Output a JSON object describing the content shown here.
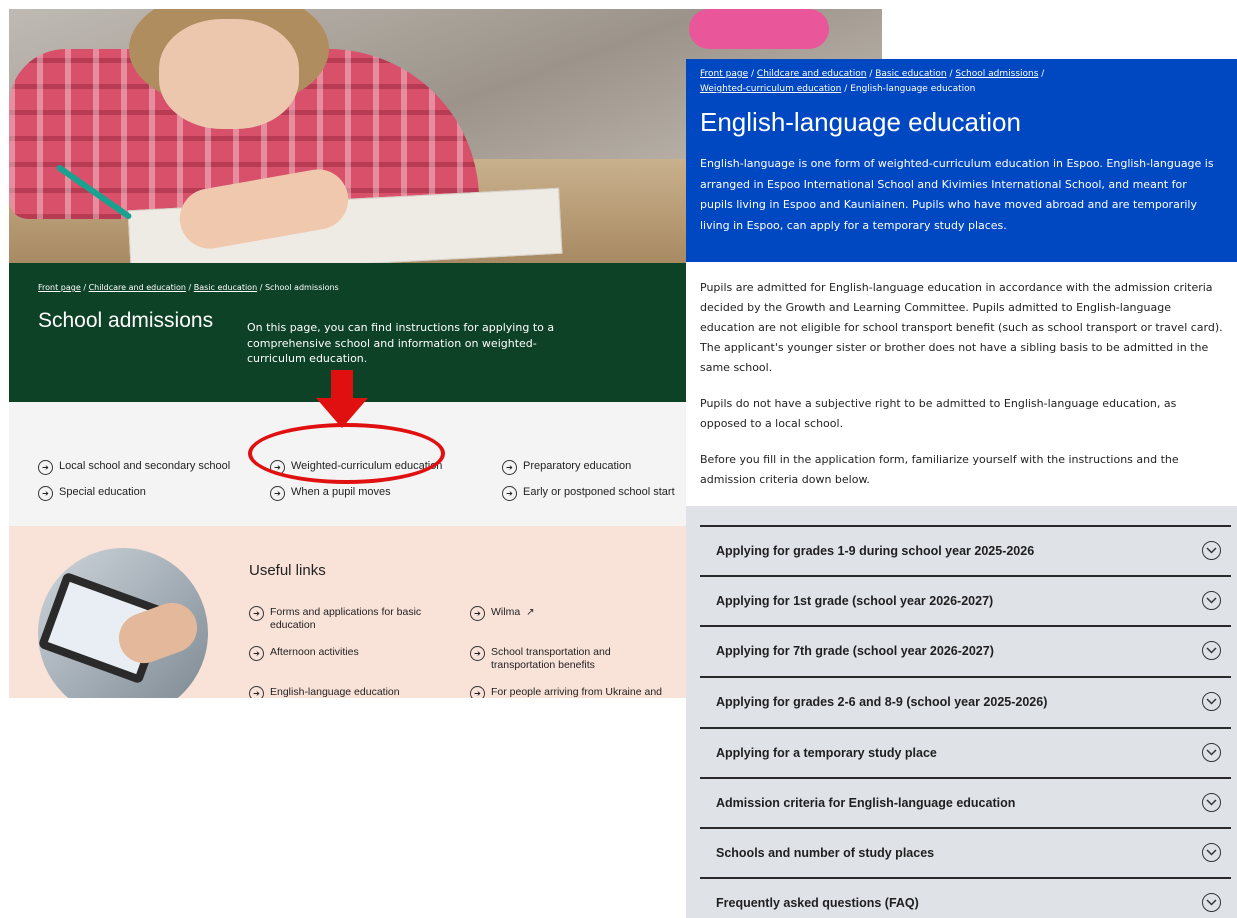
{
  "left_page": {
    "breadcrumb": {
      "items": [
        "Front page",
        "Childcare and education",
        "Basic education"
      ],
      "sep": "/",
      "current": "School admissions"
    },
    "title": "School admissions",
    "intro": "On this page, you can find instructions for applying to a comprehensive school and information on weighted-curriculum education.",
    "sub_links": [
      "Local school and secondary school",
      "Weighted-curriculum education",
      "Preparatory education",
      "Special education",
      "When a pupil moves",
      "Early or postponed school start"
    ],
    "useful_links": {
      "heading": "Useful links",
      "items": [
        "Forms and applications for basic education",
        "Wilma",
        "Afternoon activities",
        "School transportation and transportation benefits",
        "English-language education",
        "For people arriving from Ukraine and applying for basic education"
      ]
    },
    "link_icon": "circle-arrow-icon",
    "external_icon": "external-link-icon"
  },
  "annotation": {
    "color": "#e11010",
    "arrow_icon": "down-arrow-icon"
  },
  "right_page": {
    "breadcrumb": {
      "items": [
        "Front page",
        "Childcare and education",
        "Basic education",
        "School admissions",
        "Weighted-curriculum education"
      ],
      "sep": "/",
      "current": "English-language education"
    },
    "title": "English-language education",
    "intro": "English-language is one form of weighted-curriculum education in Espoo. English-language is arranged in Espoo International School and Kivimies International School, and meant for pupils living in Espoo and Kauniainen. Pupils who have moved abroad and are temporarily living in Espoo, can apply for a temporary study places.",
    "paragraphs": [
      "Pupils are admitted for English-language education in accordance with the admission criteria decided by the Growth and Learning Committee. Pupils admitted to English-language education are not eligible for school transport benefit (such as school transport or travel card). The applicant's younger sister or brother does not have a sibling basis to be admitted in the same school.",
      "Pupils do not have a subjective right to be admitted to English-language education, as opposed to a local school.",
      "Before you fill in the application form, familiarize yourself with the instructions and the admission criteria down below."
    ],
    "accordion": [
      "Applying for grades 1-9 during school year 2025-2026",
      "Applying for 1st grade (school year 2026-2027)",
      "Applying for 7th grade (school year 2026-2027)",
      "Applying for grades 2-6 and 8-9 (school year 2025-2026)",
      "Applying for a temporary study place",
      "Admission criteria for English-language education",
      "Schools and number of study places",
      "Frequently asked questions (FAQ)"
    ],
    "chevron_icon": "chevron-down-circle-icon"
  },
  "colors": {
    "left_header_bg": "#0d4226",
    "right_header_bg": "#0047c2",
    "useful_bg": "#f9e3d9",
    "accordion_bg": "#dfe2e7"
  }
}
